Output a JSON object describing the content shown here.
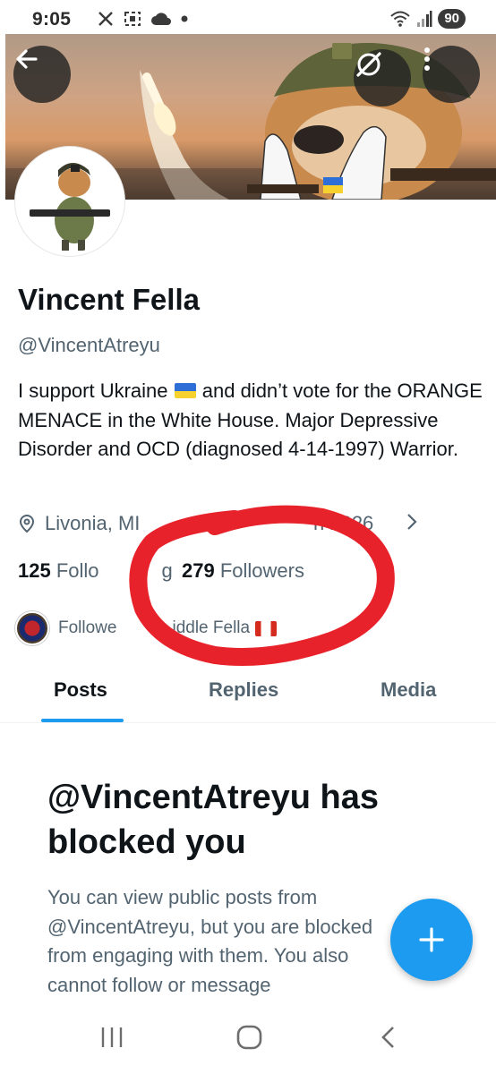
{
  "status_bar": {
    "time": "9:05",
    "battery": "90",
    "icons": [
      "x-app-icon",
      "screenshot-icon",
      "cloud-icon",
      "dot-icon",
      "wifi-icon",
      "signal-icon"
    ]
  },
  "banner": {
    "buttons": [
      "back-arrow-icon",
      "grok-icon",
      "more-vert-icon"
    ]
  },
  "profile": {
    "display_name": "Vincent Fella",
    "handle": "@VincentAtreyu",
    "bio_part1": "I support Ukraine ",
    "bio_part2": " and didn’t vote for the ORANGE MENACE in the White House. Major Depressive Disorder and OCD (diagnosed 4-14-1997) Warrior.",
    "location": "Livonia, MI",
    "joined": "h 2026",
    "following_count": "125",
    "following_label": "Follo",
    "following_label_tail": "g",
    "followers_count": "279",
    "followers_label": "Followers",
    "followed_by_start": "Followe",
    "followed_by_end": "iddle Fella"
  },
  "tabs": [
    {
      "label": "Posts",
      "active": true
    },
    {
      "label": "Replies",
      "active": false
    },
    {
      "label": "Media",
      "active": false
    }
  ],
  "blocked": {
    "title": "@VincentAtreyu has blocked you",
    "body": "You can view public posts from @VincentAtreyu, but you are blocked from engaging with them. You also cannot follow or message"
  },
  "fab": {
    "icon": "plus-icon"
  },
  "colors": {
    "accent": "#1d9bf0",
    "text_primary": "#0f1419",
    "text_secondary": "#536471",
    "annotation_red": "#e8222a"
  }
}
